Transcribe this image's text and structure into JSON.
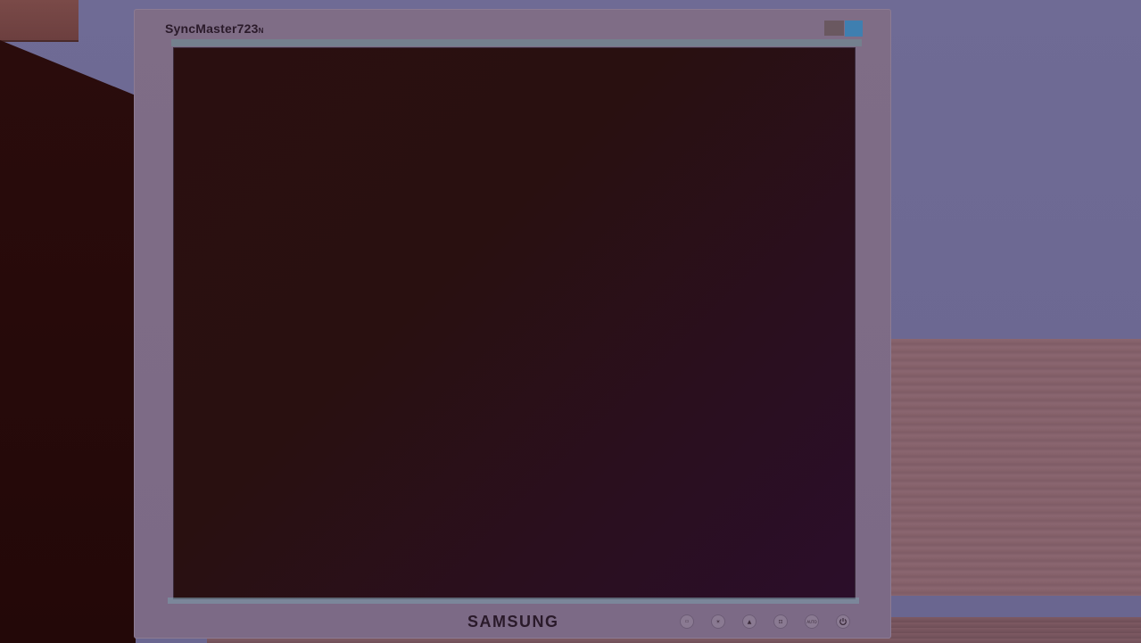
{
  "monitor": {
    "model_label": "SyncMaster723",
    "model_suffix": "N",
    "brand": "SAMSUNG",
    "accent_color": "#3f7fb0"
  },
  "buttons": [
    {
      "icon": "menu-icon",
      "label": "MENU"
    },
    {
      "icon": "brightness-icon",
      "label": "☀▾"
    },
    {
      "icon": "up-icon",
      "label": "▲"
    },
    {
      "icon": "enter-icon",
      "label": "⏎"
    },
    {
      "icon": "auto-icon",
      "label": "AUTO"
    },
    {
      "icon": "power-icon",
      "label": "⏻"
    }
  ]
}
